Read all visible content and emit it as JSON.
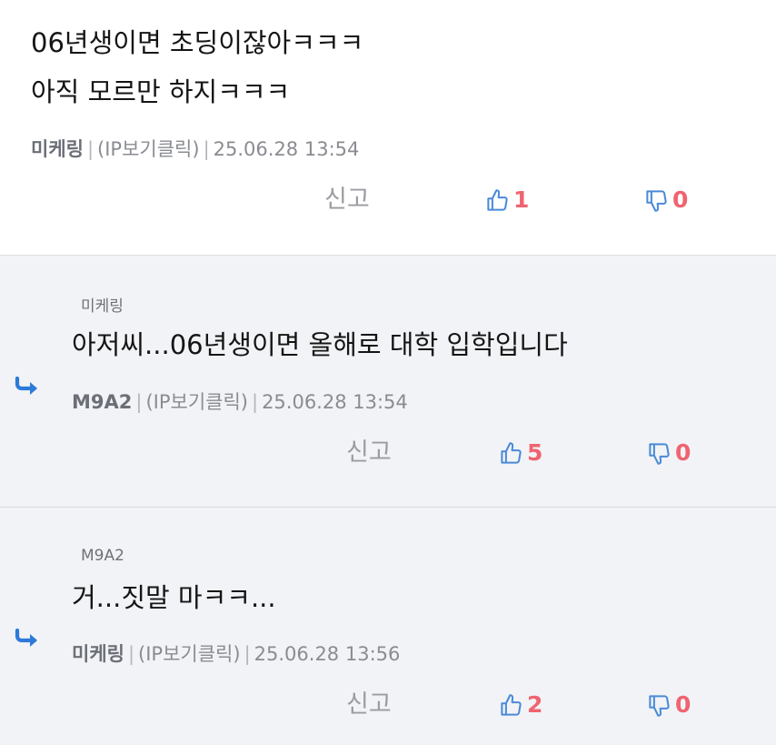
{
  "comments": [
    {
      "lines": [
        "06년생이면 초딩이잖아ㅋㅋㅋ",
        "아직 모르만 하지ㅋㅋㅋ"
      ],
      "author": "미케링",
      "ip_label": "(IP보기클릭)",
      "datetime": "25.06.28 13:54",
      "report_label": "신고",
      "likes": "1",
      "dislikes": "0"
    },
    {
      "reply_to": "미케링",
      "text": "아저씨...06년생이면 올해로 대학 입학입니다",
      "author": "M9A2",
      "ip_label": "(IP보기클릭)",
      "datetime": "25.06.28 13:54",
      "report_label": "신고",
      "likes": "5",
      "dislikes": "0"
    },
    {
      "reply_to": "M9A2",
      "text": "거...짓말 마ㅋㅋ...",
      "author": "미케링",
      "ip_label": "(IP보기클릭)",
      "datetime": "25.06.28 13:56",
      "report_label": "신고",
      "likes": "2",
      "dislikes": "0"
    }
  ],
  "separator": "|",
  "icons": {
    "like": "thumbs-up-icon",
    "dislike": "thumbs-down-icon",
    "reply": "reply-arrow-icon"
  },
  "colors": {
    "icon_blue": "#4a8ad8",
    "count_red": "#ef6470",
    "reply_bg": "#f2f3f6"
  }
}
